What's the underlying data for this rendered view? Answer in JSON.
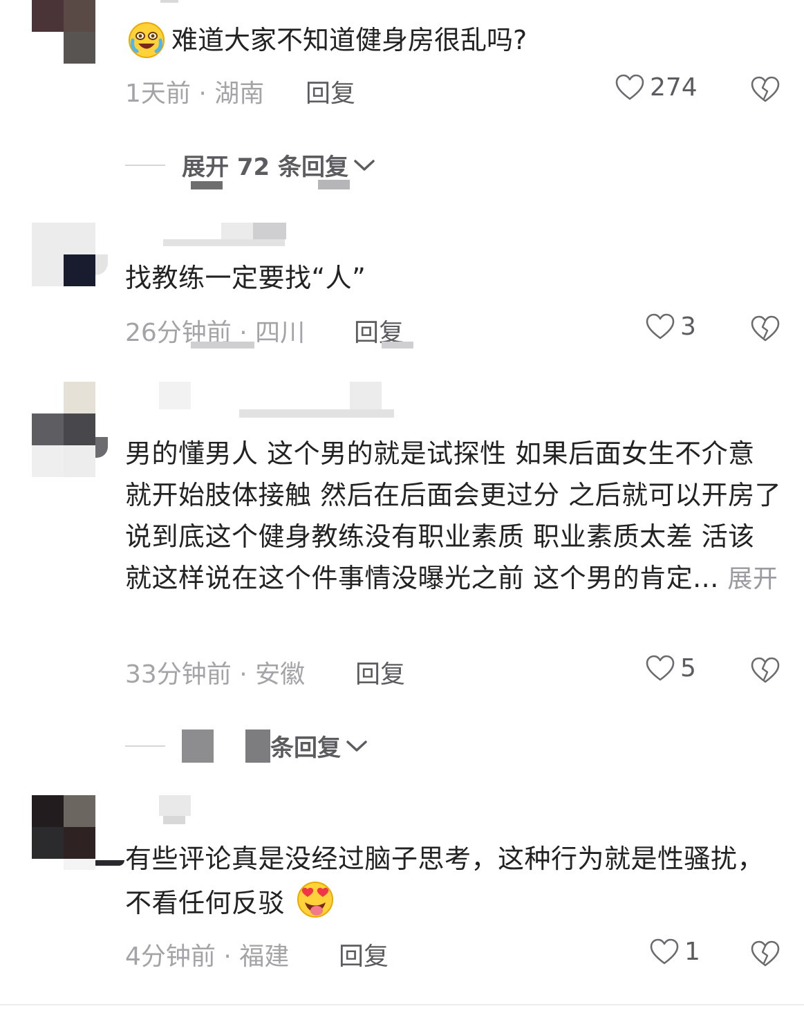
{
  "comments": [
    {
      "text": "难道大家不知道健身房很乱吗?",
      "time": "1天前",
      "location": "湖南",
      "reply_label": "回复",
      "likes": "274",
      "expand_label": "展开 72 条回复"
    },
    {
      "text": "找教练一定要找“人”",
      "time": "26分钟前",
      "location": "四川",
      "reply_label": "回复",
      "likes": "3"
    },
    {
      "text": "男的懂男人 这个男的就是试探性 如果后面女生不介意 就开始肢体接触 然后在后面会更过分 之后就可以开房了 说到底这个健身教练没有职业素质 职业素质太差 活该 就这样说在这个件事情没曝光之前 这个男的肯定...",
      "more_label": "展开",
      "time": "33分钟前",
      "location": "安徽",
      "reply_label": "回复",
      "likes": "5",
      "expand_label": "条回复"
    },
    {
      "text": "有些评论真是没经过脑子思考，这种行为就是性骚扰，不看任何反驳",
      "time": "4分钟前",
      "location": "福建",
      "reply_label": "回复",
      "likes": "1"
    }
  ],
  "separator": "·",
  "colors": {
    "meta": "#a4a4a8",
    "action": "#5b5b60",
    "text": "#222222"
  },
  "icons": [
    "heart-outline-icon",
    "broken-heart-icon",
    "chevron-down-icon",
    "crying-laughing-emoji",
    "heart-eyes-tongue-emoji"
  ]
}
